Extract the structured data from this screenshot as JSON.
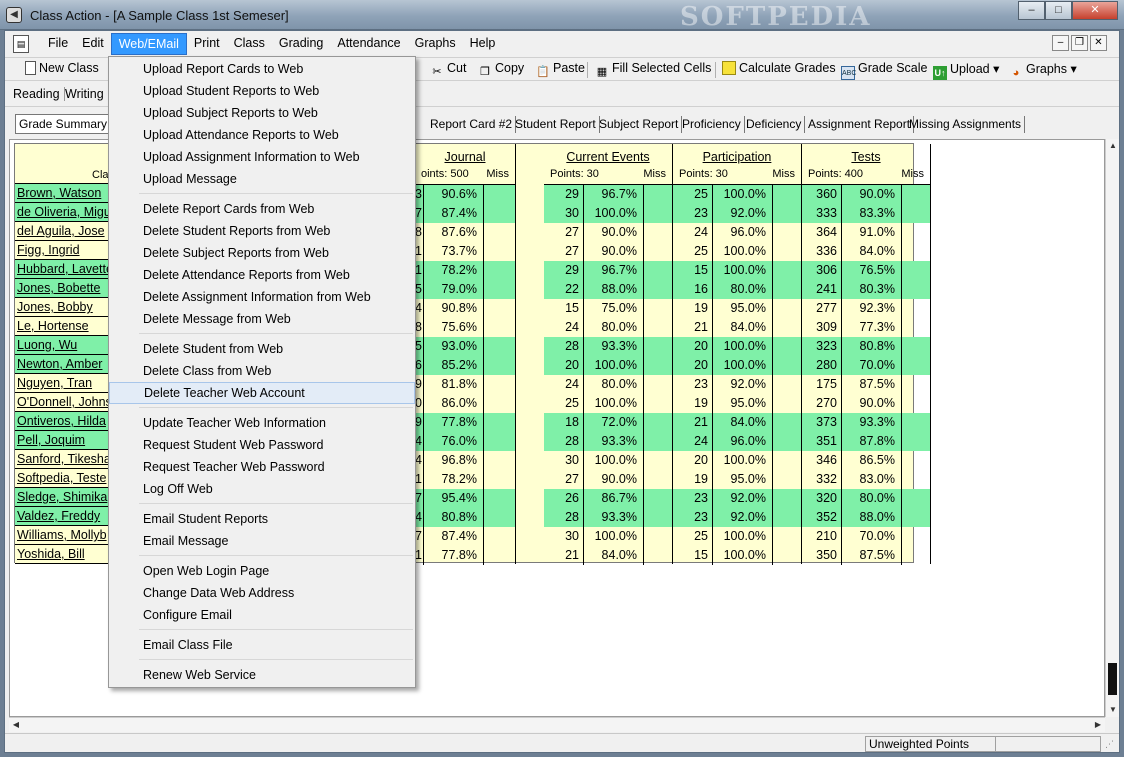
{
  "window": {
    "title": "Class Action - [A Sample Class 1st Semeser]",
    "watermark": "SOFTPEDIA",
    "min": "–",
    "max": "□",
    "close": "✕"
  },
  "menubar": [
    "File",
    "Edit",
    "Web/EMail",
    "Print",
    "Class",
    "Grading",
    "Attendance",
    "Graphs",
    "Help"
  ],
  "toolbar": {
    "new_class": "New Class",
    "cut": "Cut",
    "copy": "Copy",
    "paste": "Paste",
    "fill": "Fill Selected Cells",
    "calc": "Calculate Grades",
    "scale": "Grade Scale",
    "upload": "Upload",
    "graphs": "Graphs"
  },
  "bar2": [
    "Reading",
    "Writing"
  ],
  "tabs": [
    "Grade Summary",
    "Report Card #2",
    "Student Report",
    "Subject Report",
    "Proficiency",
    "Deficiency",
    "Assignment Report",
    "Missing Assignments"
  ],
  "names_header": "Clas",
  "students": [
    "Brown, Watson",
    "de Oliveria, Migu",
    "del Aguila, Jose",
    "Figg, Ingrid",
    "Hubbard, Lavette",
    "Jones, Bobette",
    "Jones, Bobby",
    "Le, Hortense",
    "Luong, Wu",
    "Newton, Amber",
    "Nguyen, Tran",
    "O'Donnell, Johns",
    "Ontiveros, Hilda",
    "Pell, Joquim",
    "Sanford, Tikesha",
    "Softpedia, Teste",
    "Sledge, Shimika",
    "Valdez, Freddy",
    "Williams, Mollyb",
    "Yoshida,  Bill"
  ],
  "green_rows": [
    0,
    1,
    4,
    5,
    8,
    9,
    12,
    13,
    16,
    17
  ],
  "categories": [
    {
      "title": "Journal",
      "points": "oints: 500",
      "miss": "Miss",
      "pts": [
        "3",
        "7",
        "8",
        "1",
        "1",
        "5",
        "4",
        "8",
        "5",
        "6",
        "9",
        "0",
        "9",
        "4",
        "4",
        "1",
        "7",
        "4",
        "7",
        "1"
      ],
      "pct": [
        "90.6%",
        "87.4%",
        "87.6%",
        "73.7%",
        "78.2%",
        "79.0%",
        "90.8%",
        "75.6%",
        "93.0%",
        "85.2%",
        "81.8%",
        "86.0%",
        "77.8%",
        "76.0%",
        "96.8%",
        "78.2%",
        "95.4%",
        "80.8%",
        "87.4%",
        "77.8%"
      ]
    },
    {
      "title": "Current Events",
      "points": "Points: 30",
      "miss": "Miss",
      "pts": [
        "29",
        "30",
        "27",
        "27",
        "29",
        "22",
        "15",
        "24",
        "28",
        "20",
        "24",
        "25",
        "18",
        "28",
        "30",
        "27",
        "26",
        "28",
        "30",
        "21"
      ],
      "pct": [
        "96.7%",
        "100.0%",
        "90.0%",
        "90.0%",
        "96.7%",
        "88.0%",
        "75.0%",
        "80.0%",
        "93.3%",
        "100.0%",
        "80.0%",
        "100.0%",
        "72.0%",
        "93.3%",
        "100.0%",
        "90.0%",
        "86.7%",
        "93.3%",
        "100.0%",
        "84.0%"
      ]
    },
    {
      "title": "Participation",
      "points": "Points: 30",
      "miss": "Miss",
      "pts": [
        "25",
        "23",
        "24",
        "25",
        "15",
        "16",
        "19",
        "21",
        "20",
        "20",
        "23",
        "19",
        "21",
        "24",
        "20",
        "19",
        "23",
        "23",
        "25",
        "15"
      ],
      "pct": [
        "100.0%",
        "92.0%",
        "96.0%",
        "100.0%",
        "100.0%",
        "80.0%",
        "95.0%",
        "84.0%",
        "100.0%",
        "100.0%",
        "92.0%",
        "95.0%",
        "84.0%",
        "96.0%",
        "100.0%",
        "95.0%",
        "92.0%",
        "92.0%",
        "100.0%",
        "100.0%"
      ]
    },
    {
      "title": "Tests",
      "points": "Points: 400",
      "miss": "Miss",
      "pts": [
        "360",
        "333",
        "364",
        "336",
        "306",
        "241",
        "277",
        "309",
        "323",
        "280",
        "175",
        "270",
        "373",
        "351",
        "346",
        "332",
        "320",
        "352",
        "210",
        "350"
      ],
      "pct": [
        "90.0%",
        "83.3%",
        "91.0%",
        "84.0%",
        "76.5%",
        "80.3%",
        "92.3%",
        "77.3%",
        "80.8%",
        "70.0%",
        "87.5%",
        "90.0%",
        "93.3%",
        "87.8%",
        "86.5%",
        "83.0%",
        "80.0%",
        "88.0%",
        "70.0%",
        "87.5%"
      ]
    }
  ],
  "dropdown_groups": [
    [
      "Upload Report Cards to Web",
      "Upload Student Reports to Web",
      "Upload Subject Reports to Web",
      "Upload Attendance Reports to Web",
      "Upload Assignment Information to Web",
      "Upload Message"
    ],
    [
      "Delete Report Cards from Web",
      "Delete Student Reports from Web",
      "Delete Subject Reports from Web",
      "Delete Attendance Reports from Web",
      "Delete Assignment Information from Web",
      "Delete Message from Web"
    ],
    [
      "Delete Student from Web",
      "Delete Class from Web",
      "Delete Teacher Web Account"
    ],
    [
      "Update Teacher Web Information",
      "Request Student Web Password",
      "Request Teacher Web Password",
      "Log Off Web"
    ],
    [
      "Email Student Reports",
      "Email Message"
    ],
    [
      "Open Web Login Page",
      "Change Data Web Address",
      "Configure Email"
    ],
    [
      "Email Class File"
    ],
    [
      "Renew Web Service"
    ]
  ],
  "dropdown_hover": "Delete Teacher Web Account",
  "status": {
    "weighting": "Unweighted Points"
  },
  "colors": {
    "row_yellow": "#ffffd2",
    "row_green": "#7ff0a8",
    "menu_highlight": "#3399ff"
  }
}
